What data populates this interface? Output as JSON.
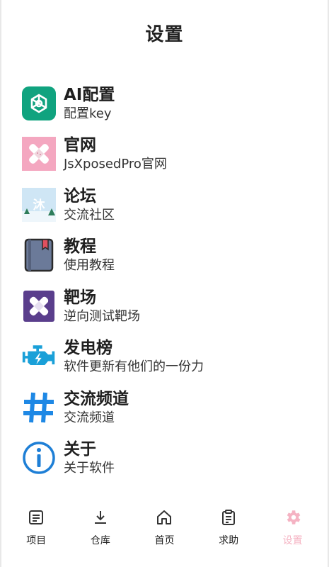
{
  "page": {
    "title": "设置"
  },
  "menu": [
    {
      "title": "AI配置",
      "subtitle": "配置key",
      "icon": "openai-icon"
    },
    {
      "title": "官网",
      "subtitle": "JsXposedPro官网",
      "icon": "patch-icon"
    },
    {
      "title": "论坛",
      "subtitle": "交流社区",
      "icon": "forum-snow-icon"
    },
    {
      "title": "教程",
      "subtitle": "使用教程",
      "icon": "book-icon"
    },
    {
      "title": "靶场",
      "subtitle": "逆向测试靶场",
      "icon": "target-patch-icon"
    },
    {
      "title": "发电榜",
      "subtitle": "软件更新有他们的一份力",
      "icon": "engine-icon"
    },
    {
      "title": "交流频道",
      "subtitle": "交流频道",
      "icon": "hash-icon"
    },
    {
      "title": "关于",
      "subtitle": "关于软件",
      "icon": "info-icon"
    }
  ],
  "nav": [
    {
      "label": "项目",
      "icon": "list-icon"
    },
    {
      "label": "仓库",
      "icon": "download-icon"
    },
    {
      "label": "首页",
      "icon": "home-icon"
    },
    {
      "label": "求助",
      "icon": "clipboard-icon"
    },
    {
      "label": "设置",
      "icon": "gear-icon",
      "active": true
    }
  ],
  "colors": {
    "openai_bg": "#10a37f",
    "patch_bg": "#f4a7c0",
    "book_bg": "#6b7a99",
    "target_bg": "#5a3e8c",
    "engine": "#1aa0d8",
    "hash": "#1e88e5",
    "info": "#1e7fd6",
    "nav_active": "#f5b3c3"
  }
}
